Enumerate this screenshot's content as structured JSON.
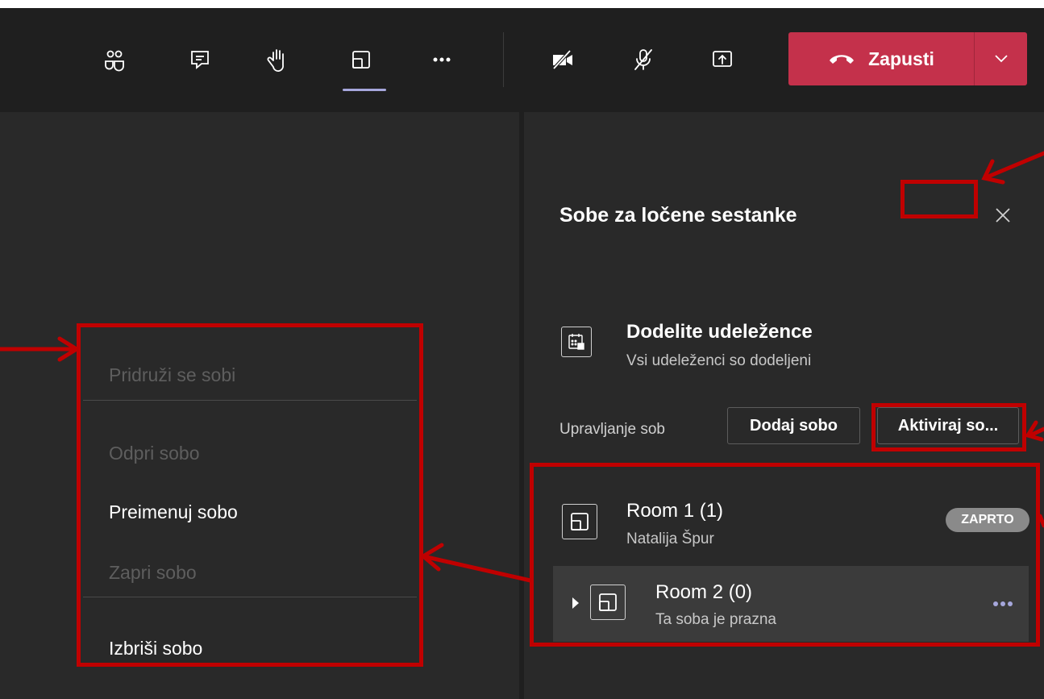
{
  "toolbar": {
    "buttons": [
      {
        "name": "participants-icon"
      },
      {
        "name": "chat-icon"
      },
      {
        "name": "raise-hand-icon"
      },
      {
        "name": "breakout-rooms-icon"
      },
      {
        "name": "more-actions-icon"
      },
      {
        "name": "camera-off-icon"
      },
      {
        "name": "mic-off-icon"
      },
      {
        "name": "share-tray-icon"
      }
    ],
    "leave_label": "Zapusti",
    "leave_icon": "hang-up-icon",
    "leave_color": "#c4314b"
  },
  "context_menu": {
    "items": [
      {
        "label": "Pridruži se sobi",
        "enabled": false
      },
      {
        "label": "Odpri sobo",
        "enabled": false
      },
      {
        "label": "Preimenuj sobo",
        "enabled": true
      },
      {
        "label": "Zapri sobo",
        "enabled": false
      },
      {
        "label": "Izbriši sobo",
        "enabled": true
      }
    ]
  },
  "panel": {
    "title": "Sobe za ločene sestanke",
    "more_label": "···",
    "assign": {
      "title": "Dodelite udeležence",
      "subtitle": "Vsi udeleženci so dodeljeni"
    },
    "manage_label": "Upravljanje sob",
    "add_room_label": "Dodaj sobo",
    "activate_label": "Aktiviraj so...",
    "rooms": [
      {
        "name": "Room 1 (1)",
        "subtitle": "Natalija Špur",
        "badge": "ZAPRTO"
      },
      {
        "name": "Room 2 (0)",
        "subtitle": "Ta soba je prazna"
      }
    ]
  },
  "colors": {
    "annotation": "#c00000",
    "accent": "#a6a7dc",
    "background": "#292929"
  }
}
